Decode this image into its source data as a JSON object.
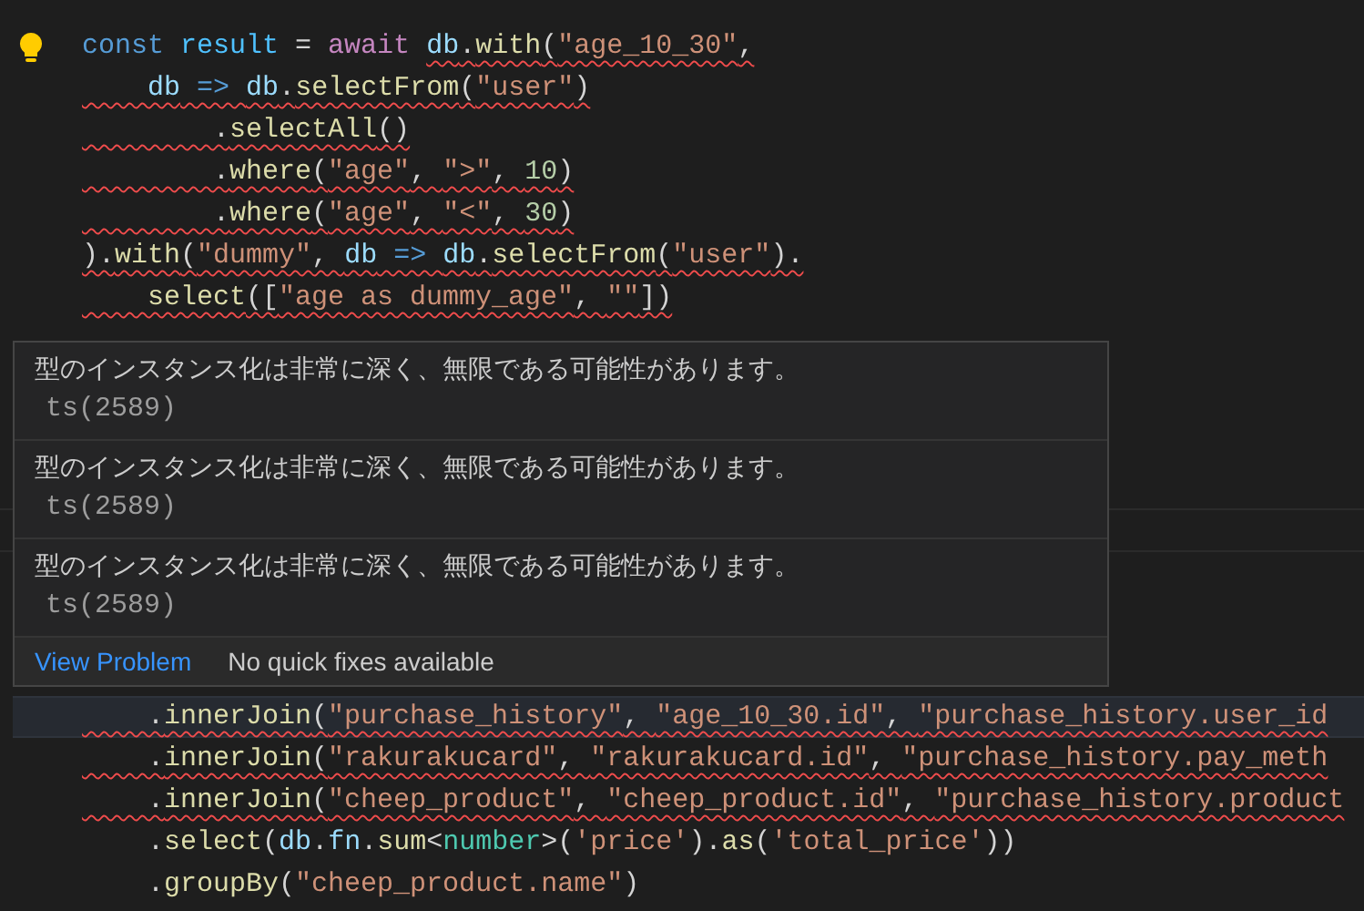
{
  "editor": {
    "lines_above": [
      {
        "tokens": [
          {
            "text": "const ",
            "kind": "storage",
            "error": false
          },
          {
            "text": "result",
            "kind": "constant",
            "error": false
          },
          {
            "text": " = ",
            "kind": "plain",
            "error": false
          },
          {
            "text": "await ",
            "kind": "control",
            "error": false
          },
          {
            "text": "db",
            "kind": "variable",
            "error": true
          },
          {
            "text": ".",
            "kind": "plain",
            "error": true
          },
          {
            "text": "with",
            "kind": "function",
            "error": true
          },
          {
            "text": "(",
            "kind": "plain",
            "error": true
          },
          {
            "text": "\"age_10_30\"",
            "kind": "string",
            "error": true
          },
          {
            "text": ",",
            "kind": "plain",
            "error": true
          }
        ],
        "error": false,
        "lightbulb": true,
        "current": false
      },
      {
        "tokens": [
          {
            "text": "    db",
            "kind": "variable"
          },
          {
            "text": " => ",
            "kind": "storage"
          },
          {
            "text": "db",
            "kind": "variable"
          },
          {
            "text": ".",
            "kind": "plain"
          },
          {
            "text": "selectFrom",
            "kind": "function"
          },
          {
            "text": "(",
            "kind": "plain"
          },
          {
            "text": "\"user\"",
            "kind": "string"
          },
          {
            "text": ")",
            "kind": "plain"
          }
        ],
        "error": true,
        "lightbulb": false,
        "current": false
      },
      {
        "tokens": [
          {
            "text": "        .",
            "kind": "plain"
          },
          {
            "text": "selectAll",
            "kind": "function"
          },
          {
            "text": "()",
            "kind": "plain"
          }
        ],
        "error": true,
        "lightbulb": false,
        "current": false
      },
      {
        "tokens": [
          {
            "text": "        .",
            "kind": "plain"
          },
          {
            "text": "where",
            "kind": "function"
          },
          {
            "text": "(",
            "kind": "plain"
          },
          {
            "text": "\"age\"",
            "kind": "string"
          },
          {
            "text": ", ",
            "kind": "plain"
          },
          {
            "text": "\">\"",
            "kind": "string"
          },
          {
            "text": ", ",
            "kind": "plain"
          },
          {
            "text": "10",
            "kind": "number"
          },
          {
            "text": ")",
            "kind": "plain"
          }
        ],
        "error": true,
        "lightbulb": false,
        "current": false
      },
      {
        "tokens": [
          {
            "text": "        .",
            "kind": "plain"
          },
          {
            "text": "where",
            "kind": "function"
          },
          {
            "text": "(",
            "kind": "plain"
          },
          {
            "text": "\"age\"",
            "kind": "string"
          },
          {
            "text": ", ",
            "kind": "plain"
          },
          {
            "text": "\"<\"",
            "kind": "string"
          },
          {
            "text": ", ",
            "kind": "plain"
          },
          {
            "text": "30",
            "kind": "number"
          },
          {
            "text": ")",
            "kind": "plain"
          }
        ],
        "error": true,
        "lightbulb": false,
        "current": false
      },
      {
        "tokens": [
          {
            "text": ").",
            "kind": "plain"
          },
          {
            "text": "with",
            "kind": "function"
          },
          {
            "text": "(",
            "kind": "plain"
          },
          {
            "text": "\"dummy\"",
            "kind": "string"
          },
          {
            "text": ", ",
            "kind": "plain"
          },
          {
            "text": "db",
            "kind": "variable"
          },
          {
            "text": " => ",
            "kind": "storage"
          },
          {
            "text": "db",
            "kind": "variable"
          },
          {
            "text": ".",
            "kind": "plain"
          },
          {
            "text": "selectFrom",
            "kind": "function"
          },
          {
            "text": "(",
            "kind": "plain"
          },
          {
            "text": "\"user\"",
            "kind": "string"
          },
          {
            "text": ").",
            "kind": "plain"
          }
        ],
        "error": true,
        "lightbulb": false,
        "current": false
      },
      {
        "tokens": [
          {
            "text": "    select",
            "kind": "function"
          },
          {
            "text": "([",
            "kind": "plain"
          },
          {
            "text": "\"age as dummy_age\"",
            "kind": "string"
          },
          {
            "text": ", ",
            "kind": "plain"
          },
          {
            "text": "\"\"",
            "kind": "string"
          },
          {
            "text": "])",
            "kind": "plain"
          }
        ],
        "error": true,
        "lightbulb": false,
        "current": false
      }
    ],
    "lines_below": [
      {
        "tokens": [
          {
            "text": "    .",
            "kind": "plain"
          },
          {
            "text": "innerJoin",
            "kind": "function"
          },
          {
            "text": "(",
            "kind": "plain"
          },
          {
            "text": "\"purchase_history\"",
            "kind": "string"
          },
          {
            "text": ", ",
            "kind": "plain"
          },
          {
            "text": "\"age_10_30.id\"",
            "kind": "string"
          },
          {
            "text": ", ",
            "kind": "plain"
          },
          {
            "text": "\"purchase_history.user_id",
            "kind": "string"
          }
        ],
        "error": true,
        "lightbulb": false,
        "current": true
      },
      {
        "tokens": [
          {
            "text": "    .",
            "kind": "plain"
          },
          {
            "text": "innerJoin",
            "kind": "function"
          },
          {
            "text": "(",
            "kind": "plain"
          },
          {
            "text": "\"rakurakucard\"",
            "kind": "string"
          },
          {
            "text": ", ",
            "kind": "plain"
          },
          {
            "text": "\"rakurakucard.id\"",
            "kind": "string"
          },
          {
            "text": ", ",
            "kind": "plain"
          },
          {
            "text": "\"purchase_history.pay_meth",
            "kind": "string"
          }
        ],
        "error": true,
        "lightbulb": false,
        "current": false
      },
      {
        "tokens": [
          {
            "text": "    .",
            "kind": "plain"
          },
          {
            "text": "innerJoin",
            "kind": "function"
          },
          {
            "text": "(",
            "kind": "plain"
          },
          {
            "text": "\"cheep_product\"",
            "kind": "string"
          },
          {
            "text": ", ",
            "kind": "plain"
          },
          {
            "text": "\"cheep_product.id\"",
            "kind": "string"
          },
          {
            "text": ", ",
            "kind": "plain"
          },
          {
            "text": "\"purchase_history.product",
            "kind": "string"
          }
        ],
        "error": true,
        "lightbulb": false,
        "current": false
      },
      {
        "tokens": [
          {
            "text": "    .",
            "kind": "plain"
          },
          {
            "text": "select",
            "kind": "function"
          },
          {
            "text": "(",
            "kind": "plain"
          },
          {
            "text": "db",
            "kind": "variable"
          },
          {
            "text": ".",
            "kind": "plain"
          },
          {
            "text": "fn",
            "kind": "variable"
          },
          {
            "text": ".",
            "kind": "plain"
          },
          {
            "text": "sum",
            "kind": "function"
          },
          {
            "text": "<",
            "kind": "plain"
          },
          {
            "text": "number",
            "kind": "type"
          },
          {
            "text": ">(",
            "kind": "plain"
          },
          {
            "text": "'price'",
            "kind": "string"
          },
          {
            "text": ").",
            "kind": "plain"
          },
          {
            "text": "as",
            "kind": "function"
          },
          {
            "text": "(",
            "kind": "plain"
          },
          {
            "text": "'total_price'",
            "kind": "string"
          },
          {
            "text": "))",
            "kind": "plain"
          }
        ],
        "error": false,
        "lightbulb": false,
        "current": false
      },
      {
        "tokens": [
          {
            "text": "    .",
            "kind": "plain"
          },
          {
            "text": "groupBy",
            "kind": "function"
          },
          {
            "text": "(",
            "kind": "plain"
          },
          {
            "text": "\"cheep_product.name\"",
            "kind": "string"
          },
          {
            "text": ")",
            "kind": "plain"
          }
        ],
        "error": false,
        "lightbulb": false,
        "current": false
      }
    ]
  },
  "hover": {
    "problems": [
      {
        "message": "型のインスタンス化は非常に深く、無限である可能性があります。",
        "code": "ts(2589)"
      },
      {
        "message": "型のインスタンス化は非常に深く、無限である可能性があります。",
        "code": "ts(2589)"
      },
      {
        "message": "型のインスタンス化は非常に深く、無限である可能性があります。",
        "code": "ts(2589)"
      }
    ],
    "actions": [
      {
        "label": "View Problem",
        "kind": "link"
      },
      {
        "label": "No quick fixes available",
        "kind": "note"
      }
    ]
  }
}
